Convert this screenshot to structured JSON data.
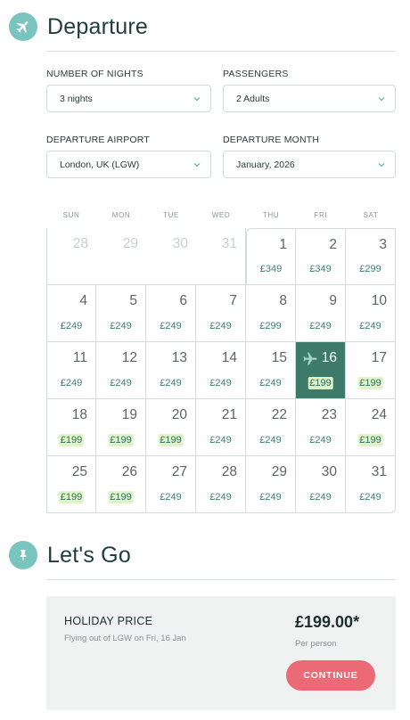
{
  "departure": {
    "title": "Departure"
  },
  "fields": {
    "nights": {
      "label": "NUMBER OF NIGHTS",
      "value": "3 nights"
    },
    "passengers": {
      "label": "PASSENGERS",
      "value": "2 Adults"
    },
    "airport": {
      "label": "DEPARTURE AIRPORT",
      "value": "London, UK (LGW)"
    },
    "month": {
      "label": "DEPARTURE MONTH",
      "value": "January, 2026"
    }
  },
  "calendar": {
    "weekdays": [
      "SUN",
      "MON",
      "TUE",
      "WED",
      "THU",
      "FRI",
      "SAT"
    ],
    "prev_month_days": [
      "28",
      "29",
      "30",
      "31"
    ],
    "selected_day": "16",
    "days": [
      {
        "day": "1",
        "price": "£349",
        "low": false
      },
      {
        "day": "2",
        "price": "£349",
        "low": false
      },
      {
        "day": "3",
        "price": "£299",
        "low": false
      },
      {
        "day": "4",
        "price": "£249",
        "low": false
      },
      {
        "day": "5",
        "price": "£249",
        "low": false
      },
      {
        "day": "6",
        "price": "£249",
        "low": false
      },
      {
        "day": "7",
        "price": "£249",
        "low": false
      },
      {
        "day": "8",
        "price": "£299",
        "low": false
      },
      {
        "day": "9",
        "price": "£249",
        "low": false
      },
      {
        "day": "10",
        "price": "£249",
        "low": false
      },
      {
        "day": "11",
        "price": "£249",
        "low": false
      },
      {
        "day": "12",
        "price": "£249",
        "low": false
      },
      {
        "day": "13",
        "price": "£249",
        "low": false
      },
      {
        "day": "14",
        "price": "£249",
        "low": false
      },
      {
        "day": "15",
        "price": "£249",
        "low": false
      },
      {
        "day": "16",
        "price": "£199",
        "low": true
      },
      {
        "day": "17",
        "price": "£199",
        "low": true
      },
      {
        "day": "18",
        "price": "£199",
        "low": true
      },
      {
        "day": "19",
        "price": "£199",
        "low": true
      },
      {
        "day": "20",
        "price": "£199",
        "low": true
      },
      {
        "day": "21",
        "price": "£249",
        "low": false
      },
      {
        "day": "22",
        "price": "£249",
        "low": false
      },
      {
        "day": "23",
        "price": "£249",
        "low": false
      },
      {
        "day": "24",
        "price": "£199",
        "low": true
      },
      {
        "day": "25",
        "price": "£199",
        "low": true
      },
      {
        "day": "26",
        "price": "£199",
        "low": true
      },
      {
        "day": "27",
        "price": "£249",
        "low": false
      },
      {
        "day": "28",
        "price": "£249",
        "low": false
      },
      {
        "day": "29",
        "price": "£249",
        "low": false
      },
      {
        "day": "30",
        "price": "£249",
        "low": false
      },
      {
        "day": "31",
        "price": "£249",
        "low": false
      }
    ]
  },
  "letsgo": {
    "title": "Let's Go"
  },
  "summary": {
    "label": "HOLIDAY PRICE",
    "sub": "Flying out of LGW on Fri, 16 Jan",
    "price": "£199.00*",
    "per": "Per person",
    "continue_label": "CONTINUE"
  },
  "colors": {
    "accent": "#79c4be",
    "selected": "#3d7a6a",
    "low_price_bg": "#e1f3c9",
    "cta": "#ec6a75"
  },
  "icons": {
    "departure": "airplane-icon",
    "letsgo": "pushpin-icon",
    "selects": "chevron-down-icon"
  }
}
